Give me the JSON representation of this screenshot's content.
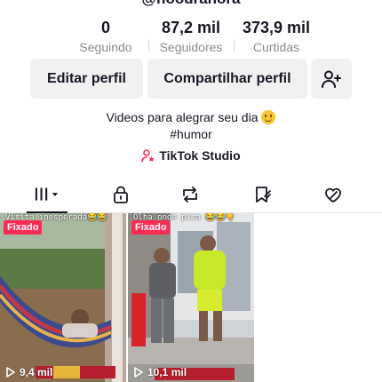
{
  "profile": {
    "handle_partial": "@hoodrahora"
  },
  "stats": [
    {
      "value": "0",
      "label": "Seguindo"
    },
    {
      "value": "87,2 mil",
      "label": "Seguidores"
    },
    {
      "value": "373,9 mil",
      "label": "Curtidas"
    }
  ],
  "actions": {
    "edit_label": "Editar perfil",
    "share_label": "Compartilhar perfil",
    "add_friend_icon": "add-user-icon"
  },
  "bio": {
    "line1": "Videos para alegrar seu dia",
    "line2": "#humor"
  },
  "studio_link": {
    "label": "TikTok Studio",
    "icon": "person-star-icon"
  },
  "tabs": [
    {
      "icon": "grid-icon",
      "active": true
    },
    {
      "icon": "lock-icon",
      "active": false
    },
    {
      "icon": "repost-icon",
      "active": false
    },
    {
      "icon": "bookmark-icon",
      "active": false
    },
    {
      "icon": "liked-heart-icon",
      "active": false
    }
  ],
  "videos": [
    {
      "pinned_label": "Fixado",
      "caption": "Visita inesperada😂😂",
      "views": "9,4 mil"
    },
    {
      "pinned_label": "Fixado",
      "caption": "Olha onde pisa 😂😂👇",
      "views": "10,1 mil"
    }
  ],
  "colors": {
    "accent": "#fe2c55",
    "text": "#161823",
    "secondary_text": "#8a8b91",
    "button_bg": "#f1f1f2"
  }
}
